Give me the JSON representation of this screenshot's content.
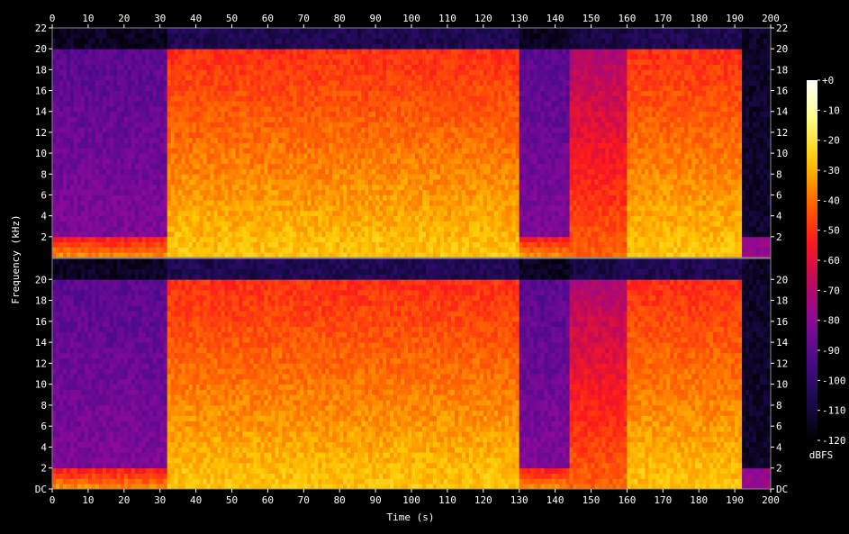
{
  "chart_data": {
    "type": "heatmap",
    "xlabel": "Time (s)",
    "ylabel": "Frequency (kHz)",
    "colorbar_label": "dBFS",
    "x_ticks": [
      "0",
      "10",
      "20",
      "30",
      "40",
      "50",
      "60",
      "70",
      "80",
      "90",
      "100",
      "110",
      "120",
      "130",
      "140",
      "150",
      "160",
      "170",
      "180",
      "190",
      "200"
    ],
    "xlim": [
      0,
      200
    ],
    "ylim": [
      0,
      22
    ],
    "y_ticks_top": [
      "2",
      "4",
      "6",
      "8",
      "10",
      "12",
      "14",
      "16",
      "18",
      "20",
      "22"
    ],
    "y_ticks_bottom": [
      "DC",
      "2",
      "4",
      "6",
      "8",
      "10",
      "12",
      "14",
      "16",
      "18",
      "20"
    ],
    "channels": 2,
    "colorbar_ticks": [
      "+0",
      "-10",
      "-20",
      "-30",
      "-40",
      "-50",
      "-60",
      "-70",
      "-80",
      "-90",
      "-100",
      "-110",
      "-120"
    ],
    "colorbar_range": [
      -120,
      0
    ],
    "colormap": [
      "#000000",
      "#1a0a4d",
      "#4a0a8c",
      "#8a0a9a",
      "#c00a5a",
      "#ff1a1a",
      "#ff6a00",
      "#ffc800",
      "#ffff80",
      "#ffffff"
    ],
    "segments": [
      {
        "start": 0,
        "end": 32,
        "level": "quiet"
      },
      {
        "start": 32,
        "end": 130,
        "level": "loud"
      },
      {
        "start": 130,
        "end": 144,
        "level": "quiet"
      },
      {
        "start": 144,
        "end": 160,
        "level": "medium"
      },
      {
        "start": 160,
        "end": 192,
        "level": "loud"
      },
      {
        "start": 192,
        "end": 200,
        "level": "silence"
      }
    ]
  }
}
